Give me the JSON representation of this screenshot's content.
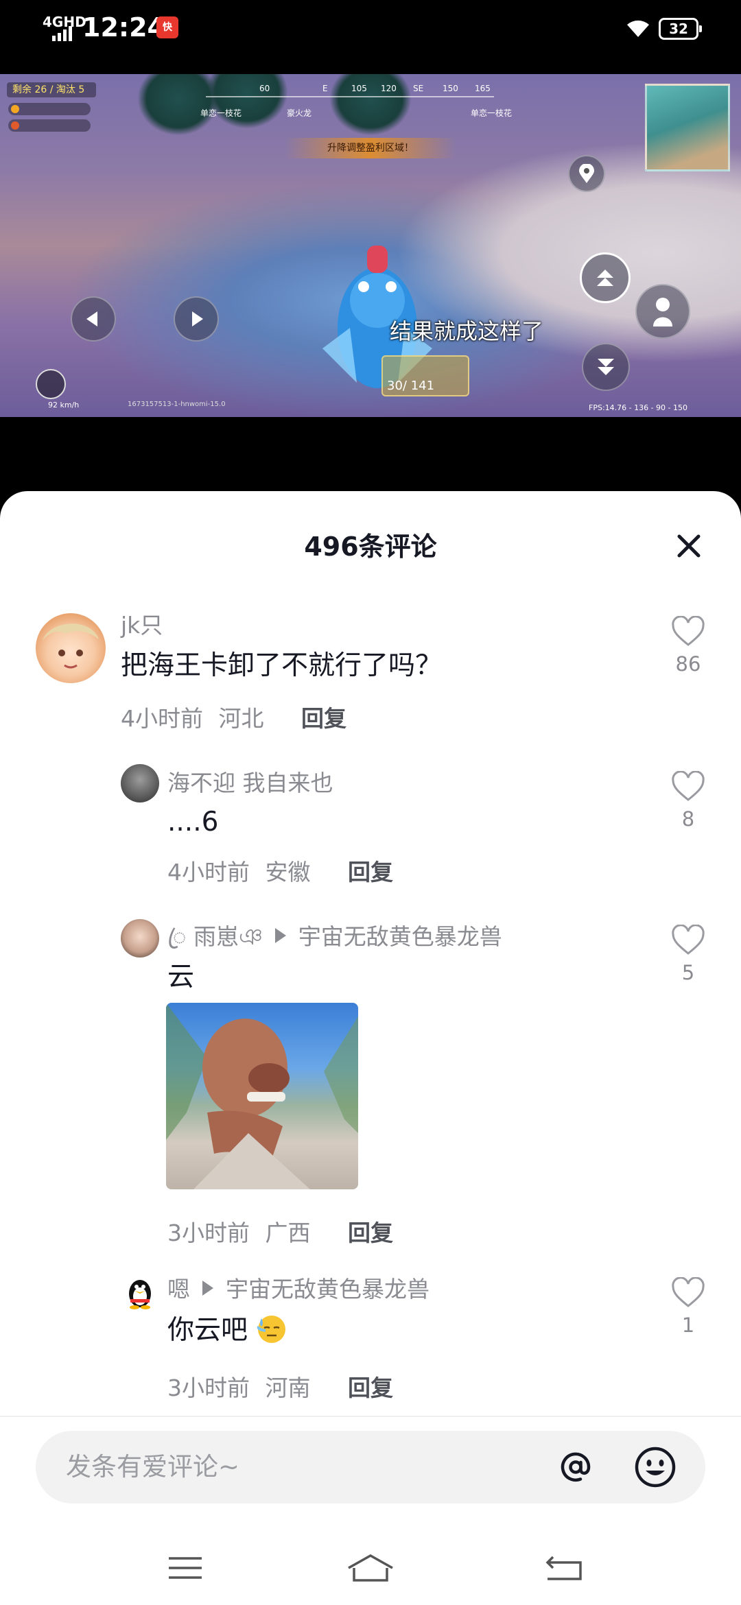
{
  "status_bar": {
    "network": "4GHD",
    "time": "12:24",
    "app_badge": "快",
    "battery": "32"
  },
  "video": {
    "subtitle": "结果就成这样了",
    "ammo": "30/ 141",
    "warning": "升降调整盈利区域！",
    "fps": "FPS:14.76 - 136 - 90 - 150",
    "clip_id": "1673157513-1-hnwomi-15.0",
    "speed": "92 km/h",
    "hud_remaining": "剩余 26 / 淘汰 5",
    "compass": [
      "60",
      "E",
      "105",
      "120",
      "SE",
      "150",
      "165"
    ],
    "players": [
      "单恋一枝花",
      "豪火龙",
      "单恋一枝花"
    ]
  },
  "comments_panel": {
    "title": "496条评论",
    "comments": [
      {
        "name": "jk只",
        "text": "把海王卡卸了不就行了吗？",
        "time": "4小时前",
        "location": "河北",
        "reply": "回复",
        "likes": "86"
      },
      {
        "name": "海不迎 我自来也",
        "text": "....6",
        "time": "4小时前",
        "location": "安徽",
        "reply": "回复",
        "likes": "8"
      },
      {
        "name": "ꦿ 雨崽ঞ",
        "reply_to": "宇宙无敌黄色暴龙兽",
        "text": "云",
        "time": "3小时前",
        "location": "广西",
        "reply": "回复",
        "likes": "5"
      },
      {
        "name": "嗯",
        "reply_to": "宇宙无敌黄色暴龙兽",
        "text": "你云吧",
        "time": "3小时前",
        "location": "河南",
        "reply": "回复",
        "likes": "1"
      }
    ]
  },
  "input_bar": {
    "placeholder": "发条有爱评论~"
  },
  "colors": {
    "secondary_text": "#8a8b91",
    "primary_text": "#161823",
    "sheet_bg": "#ffffff"
  }
}
